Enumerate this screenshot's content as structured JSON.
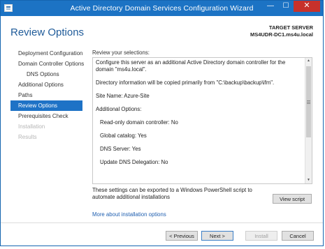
{
  "window": {
    "title": "Active Directory Domain Services Configuration Wizard",
    "minimize_glyph": "—",
    "maximize_glyph": "☐",
    "close_glyph": "✕"
  },
  "header": {
    "page_title": "Review Options",
    "target_label": "TARGET SERVER",
    "target_server": "MS4UDR-DC1.ms4u.local"
  },
  "nav": {
    "items": [
      {
        "label": "Deployment Configuration",
        "state": "normal"
      },
      {
        "label": "Domain Controller Options",
        "state": "normal"
      },
      {
        "label": "DNS Options",
        "state": "sub"
      },
      {
        "label": "Additional Options",
        "state": "normal"
      },
      {
        "label": "Paths",
        "state": "normal"
      },
      {
        "label": "Review Options",
        "state": "active"
      },
      {
        "label": "Prerequisites Check",
        "state": "normal"
      },
      {
        "label": "Installation",
        "state": "disabled"
      },
      {
        "label": "Results",
        "state": "disabled"
      }
    ]
  },
  "review": {
    "label": "Review your selections:",
    "lines": [
      "Configure this server as an additional Active Directory domain controller for the domain \"ms4u.local\".",
      "Directory information will be copied primarily from \"C:\\backup\\backup\\ifm\".",
      "Site Name: Azure-Site",
      "Additional Options:",
      "Read-only domain controller: No",
      "Global catalog: Yes",
      "DNS Server: Yes",
      "Update DNS Delegation: No"
    ]
  },
  "export": {
    "text": "These settings can be exported to a Windows PowerShell script to automate additional installations",
    "view_script_label": "View script"
  },
  "more_link": "More about installation options",
  "buttons": {
    "previous": "< Previous",
    "next": "Next >",
    "install": "Install",
    "cancel": "Cancel"
  },
  "colors": {
    "titlebar": "#1c73c4",
    "accent": "#1e72c6",
    "close": "#c7312b"
  }
}
